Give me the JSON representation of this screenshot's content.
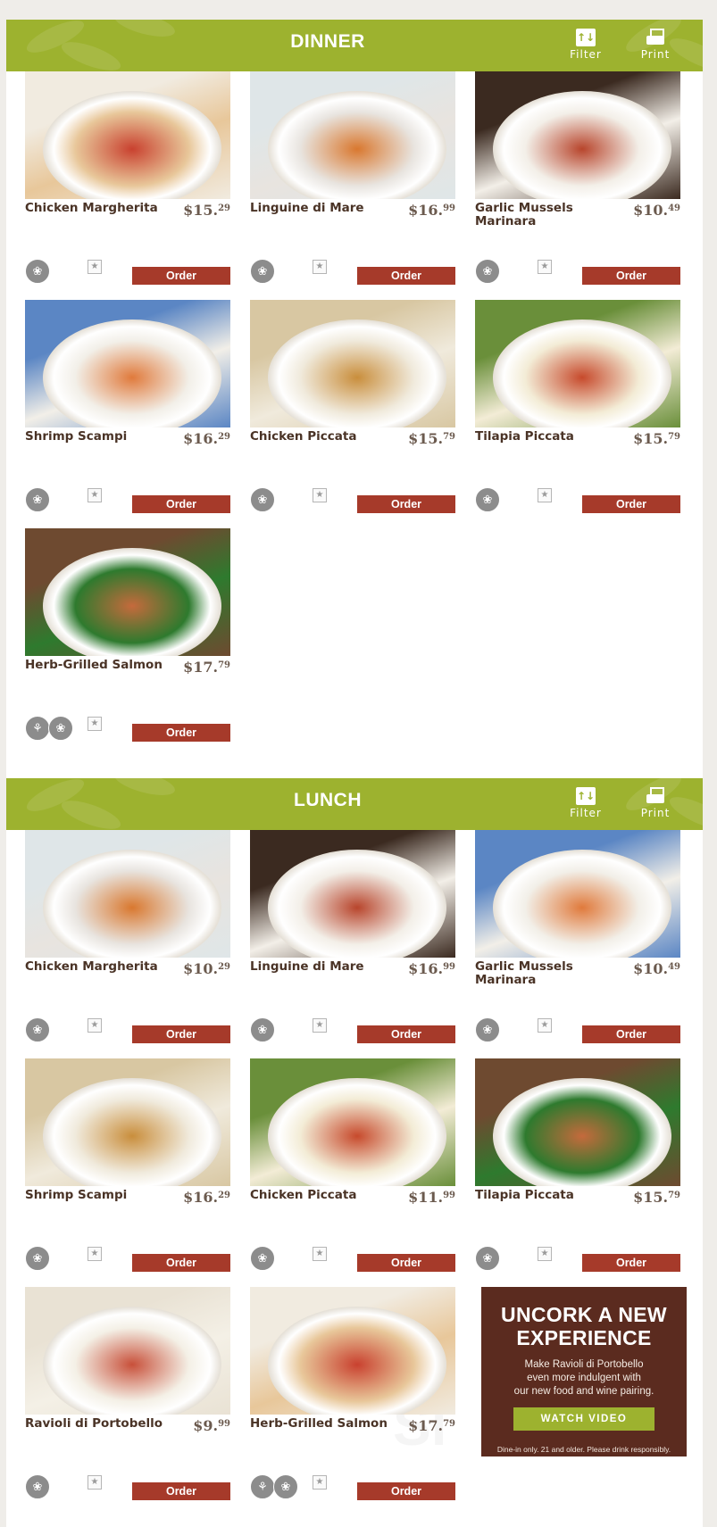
{
  "sections": [
    {
      "title": "DINNER",
      "filter_label": "Filter",
      "print_label": "Print",
      "items": [
        {
          "name": "Chicken Margherita",
          "price_whole": "$15.",
          "price_cents": "29",
          "order_label": "Order",
          "badges": [
            "olive-icon"
          ]
        },
        {
          "name": "Linguine di Mare",
          "price_whole": "$16.",
          "price_cents": "99",
          "order_label": "Order",
          "badges": [
            "olive-icon"
          ]
        },
        {
          "name": "Garlic Mussels Marinara",
          "price_whole": "$10.",
          "price_cents": "49",
          "order_label": "Order",
          "badges": [
            "olive-icon"
          ]
        },
        {
          "name": "Shrimp Scampi",
          "price_whole": "$16.",
          "price_cents": "29",
          "order_label": "Order",
          "badges": [
            "olive-icon"
          ]
        },
        {
          "name": "Chicken Piccata",
          "price_whole": "$15.",
          "price_cents": "79",
          "order_label": "Order",
          "badges": [
            "olive-icon"
          ]
        },
        {
          "name": "Tilapia Piccata",
          "price_whole": "$15.",
          "price_cents": "79",
          "order_label": "Order",
          "badges": [
            "olive-icon"
          ]
        },
        {
          "name": "Herb-Grilled Salmon",
          "price_whole": "$17.",
          "price_cents": "79",
          "order_label": "Order",
          "badges": [
            "wheat-icon",
            "olive-icon"
          ]
        }
      ]
    },
    {
      "title": "LUNCH",
      "filter_label": "Filter",
      "print_label": "Print",
      "items": [
        {
          "name": "Chicken Margherita",
          "price_whole": "$10.",
          "price_cents": "29",
          "order_label": "Order",
          "badges": [
            "olive-icon"
          ]
        },
        {
          "name": "Linguine di Mare",
          "price_whole": "$16.",
          "price_cents": "99",
          "order_label": "Order",
          "badges": [
            "olive-icon"
          ]
        },
        {
          "name": "Garlic Mussels Marinara",
          "price_whole": "$10.",
          "price_cents": "49",
          "order_label": "Order",
          "badges": [
            "olive-icon"
          ]
        },
        {
          "name": "Shrimp Scampi",
          "price_whole": "$16.",
          "price_cents": "29",
          "order_label": "Order",
          "badges": [
            "olive-icon"
          ]
        },
        {
          "name": "Chicken Piccata",
          "price_whole": "$11.",
          "price_cents": "99",
          "order_label": "Order",
          "badges": [
            "olive-icon"
          ]
        },
        {
          "name": "Tilapia Piccata",
          "price_whole": "$15.",
          "price_cents": "79",
          "order_label": "Order",
          "badges": [
            "olive-icon"
          ]
        },
        {
          "name": "Ravioli di Portobello",
          "price_whole": "$9.",
          "price_cents": "99",
          "order_label": "Order",
          "badges": [
            "olive-icon"
          ]
        },
        {
          "name": "Herb-Grilled Salmon",
          "price_whole": "$17.",
          "price_cents": "79",
          "order_label": "Order",
          "badges": [
            "wheat-icon",
            "olive-icon"
          ]
        }
      ]
    }
  ],
  "promo": {
    "headline_1": "UNCORK A NEW",
    "headline_2": "EXPERIENCE",
    "body_1": "Make Ravioli di Portobello",
    "body_2": "even more indulgent with",
    "body_3": "our new food and wine pairing.",
    "button": "WATCH VIDEO",
    "note": "Dine-in only. 21 and older. Please drink responsibly."
  },
  "colors": {
    "header_green": "#9db22f",
    "order_red": "#a63a2a",
    "text_brown": "#4a3326",
    "promo_brown": "#5b2b1f"
  }
}
